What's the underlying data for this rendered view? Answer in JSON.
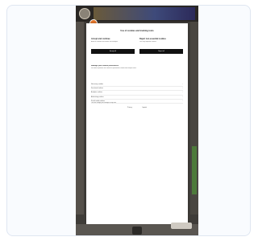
{
  "modal": {
    "title": "Use of cookies and tracking tools",
    "left": {
      "heading": "Accept and continue",
      "text": "Allow all cookies and similar technologies.",
      "button": "Accept all"
    },
    "right": {
      "heading": "Reject non-essential cookies",
      "text": "Use only required cookies.",
      "button": "Reject all"
    },
    "section_heading": "Manage your cookie preferences",
    "section_text": "We and our partners use cookies to personalise content and analyse traffic.",
    "list": [
      {
        "label": "Necessary cookies"
      },
      {
        "label": "Functional cookies"
      },
      {
        "label": "Analytics cookies"
      },
      {
        "label": "Advertising cookies"
      },
      {
        "label": "Social media cookies"
      }
    ],
    "note": "You can change your settings at any time.",
    "links": [
      "Privacy",
      "Imprint"
    ]
  },
  "colors": {
    "page_background": "#ffffff",
    "card_border": "#dfe6f1",
    "phone_background": "#3f3c38",
    "primary_button": "#111111",
    "gear_accent": "#e0742a"
  },
  "icons": {
    "gear": "gear-icon",
    "chevron": "chevron-right-icon",
    "logo": "site-logo-icon"
  }
}
